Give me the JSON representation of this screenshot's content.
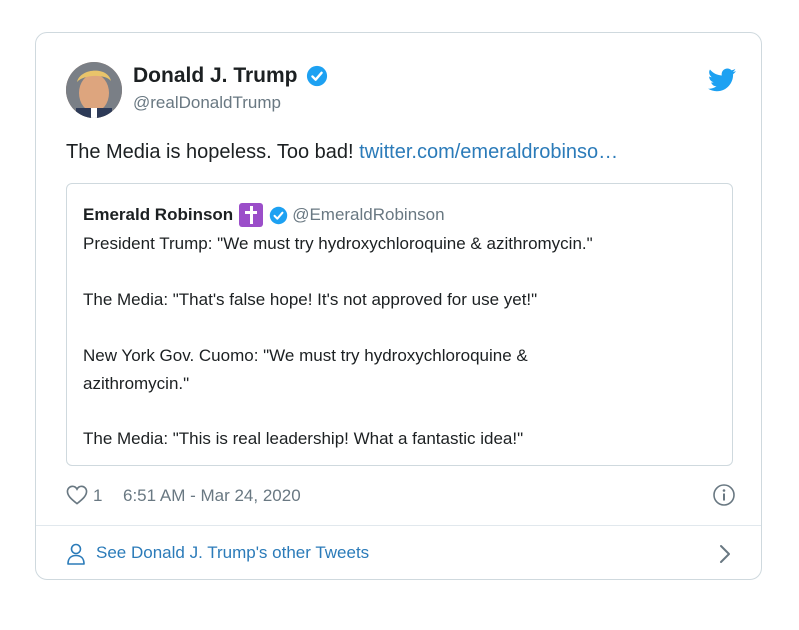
{
  "tweet": {
    "author": {
      "display_name": "Donald J. Trump",
      "handle": "@realDonaldTrump"
    },
    "text": "The Media is hopeless. Too bad! ",
    "link": "twitter.com/emeraldrobinso…",
    "quoted": {
      "display_name": "Emerald Robinson",
      "handle": "@EmeraldRobinson",
      "lines": [
        "President Trump: \"We must try hydroxychloroquine & azithromycin.\"",
        "The Media: \"That's false hope! It's not approved for use yet!\"",
        "New York Gov. Cuomo: \"We must try hydroxychloroquine &",
        "azithromycin.\"",
        "The Media: \"This is real leadership! What a fantastic idea!\""
      ]
    },
    "like_count": "1",
    "timestamp": "6:51 AM - Mar 24, 2020",
    "see_more_label": "See Donald J. Trump's other Tweets"
  },
  "icons": {
    "verified": "verified-badge-icon",
    "twitter_logo": "twitter-bird-icon",
    "cross": "latin-cross-emoji-icon",
    "heart": "heart-outline-icon",
    "info": "info-circle-icon",
    "person": "person-outline-icon",
    "chevron": "chevron-right-icon"
  },
  "colors": {
    "link": "#2b7bb9",
    "verified": "#1da1f2",
    "muted": "#697882",
    "border": "#cfd9de",
    "cross_bg": "#9b4ec9"
  }
}
